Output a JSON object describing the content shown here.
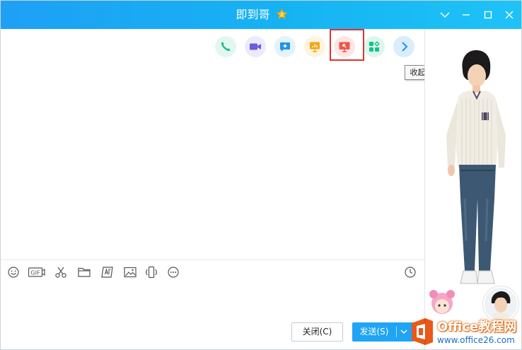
{
  "window": {
    "title": "即到哥"
  },
  "toolbar": {
    "items": [
      {
        "name": "voice-call",
        "icon": "phone-icon"
      },
      {
        "name": "video-call",
        "icon": "video-camera-icon"
      },
      {
        "name": "message",
        "icon": "chat-plus-icon"
      },
      {
        "name": "share-screen",
        "icon": "presentation-icon"
      },
      {
        "name": "remote-assist",
        "icon": "remote-screen-icon"
      },
      {
        "name": "apps",
        "icon": "apps-grid-icon"
      },
      {
        "name": "collapse",
        "icon": "chevron-right-icon"
      }
    ],
    "tooltip": "收起"
  },
  "input_toolbar": {
    "icons": [
      "smiley-icon",
      "gif-icon",
      "scissors-icon",
      "folder-icon",
      "font-style-icon",
      "image-icon",
      "shake-icon",
      "more-icon",
      "history-clock-icon"
    ],
    "gif_label": "GIF"
  },
  "buttons": {
    "close_label": "关闭(C)",
    "send_label": "发送(S)"
  },
  "watermark": {
    "text": "Office教程网",
    "url": "www.office26.com"
  },
  "colors": {
    "titlebar": "#1ea0f5",
    "send_button": "#1fa5f3",
    "highlight_box": "#e0332e"
  }
}
